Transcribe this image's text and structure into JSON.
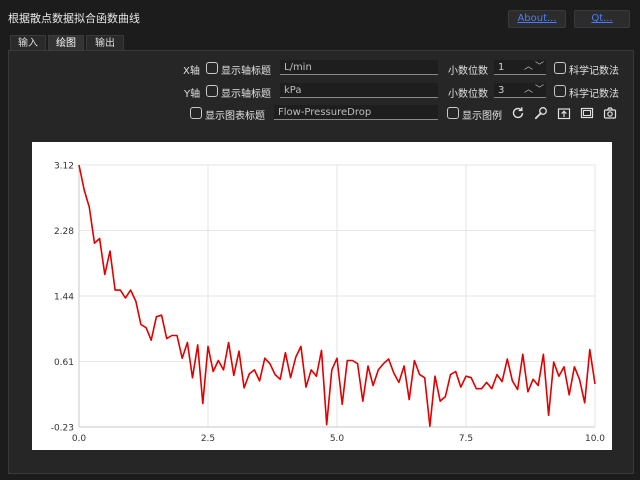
{
  "window": {
    "title": "根据散点数据拟合函数曲线",
    "about_label": "About...",
    "qt_label": "Qt..."
  },
  "tabs": [
    {
      "label": "输入",
      "active": false
    },
    {
      "label": "绘图",
      "active": true
    },
    {
      "label": "输出",
      "active": false
    }
  ],
  "controls": {
    "x_axis": {
      "axis_label": "X轴",
      "show_title_label": "显示轴标题",
      "title_value": "L/min",
      "decimals_label": "小数位数",
      "decimals_value": "1",
      "sci_label": "科学记数法"
    },
    "y_axis": {
      "axis_label": "Y轴",
      "show_title_label": "显示轴标题",
      "title_value": "kPa",
      "decimals_label": "小数位数",
      "decimals_value": "3",
      "sci_label": "科学记数法"
    },
    "chart_title": {
      "show_label": "显示图表标题",
      "value": "Flow-PressureDrop"
    },
    "legend_label": "显示图例",
    "icons": [
      "refresh-icon",
      "wrench-icon",
      "export-icon",
      "fullscreen-icon",
      "camera-icon"
    ]
  },
  "chart_data": {
    "type": "line",
    "title": "",
    "xlabel": "",
    "ylabel": "",
    "xlim": [
      0,
      10
    ],
    "ylim": [
      -0.23,
      3.12
    ],
    "xticks": [
      "0.0",
      "2.5",
      "5.0",
      "7.5",
      "10.0"
    ],
    "yticks": [
      "3.12",
      "2.28",
      "1.44",
      "0.61",
      "-0.23"
    ],
    "grid": true,
    "line_color": "#e00000",
    "x": [
      0.0,
      0.1,
      0.2,
      0.3,
      0.4,
      0.5,
      0.6,
      0.7,
      0.8,
      0.9,
      1.0,
      1.1,
      1.2,
      1.3,
      1.4,
      1.5,
      1.6,
      1.7,
      1.8,
      1.9,
      2.0,
      2.1,
      2.2,
      2.3,
      2.4,
      2.5,
      2.6,
      2.7,
      2.8,
      2.9,
      3.0,
      3.1,
      3.2,
      3.3,
      3.4,
      3.5,
      3.6,
      3.7,
      3.8,
      3.9,
      4.0,
      4.1,
      4.2,
      4.3,
      4.4,
      4.5,
      4.6,
      4.7,
      4.8,
      4.9,
      5.0,
      5.1,
      5.2,
      5.3,
      5.4,
      5.5,
      5.6,
      5.7,
      5.8,
      5.9,
      6.0,
      6.1,
      6.2,
      6.3,
      6.4,
      6.5,
      6.6,
      6.7,
      6.8,
      6.9,
      7.0,
      7.1,
      7.2,
      7.3,
      7.4,
      7.5,
      7.6,
      7.7,
      7.8,
      7.9,
      8.0,
      8.1,
      8.2,
      8.3,
      8.4,
      8.5,
      8.6,
      8.7,
      8.8,
      8.9,
      9.0,
      9.1,
      9.2,
      9.3,
      9.4,
      9.5,
      9.6,
      9.7,
      9.8,
      9.9,
      10.0
    ],
    "y": [
      3.12,
      2.8,
      2.58,
      2.12,
      2.18,
      1.72,
      2.02,
      1.52,
      1.52,
      1.42,
      1.52,
      1.38,
      1.08,
      1.04,
      0.88,
      1.18,
      1.2,
      0.9,
      0.94,
      0.94,
      0.65,
      0.85,
      0.4,
      0.82,
      0.07,
      0.8,
      0.48,
      0.62,
      0.5,
      0.85,
      0.43,
      0.74,
      0.27,
      0.45,
      0.5,
      0.36,
      0.65,
      0.58,
      0.44,
      0.38,
      0.72,
      0.4,
      0.66,
      0.8,
      0.28,
      0.5,
      0.42,
      0.75,
      -0.2,
      0.5,
      0.65,
      0.06,
      0.62,
      0.62,
      0.58,
      0.1,
      0.55,
      0.3,
      0.5,
      0.58,
      0.64,
      0.46,
      0.34,
      0.55,
      0.12,
      0.62,
      0.44,
      0.4,
      -0.22,
      0.42,
      0.1,
      0.16,
      0.44,
      0.48,
      0.28,
      0.42,
      0.4,
      0.26,
      0.26,
      0.34,
      0.26,
      0.44,
      0.35,
      0.64,
      0.36,
      0.25,
      0.7,
      0.22,
      0.38,
      0.3,
      0.7,
      -0.08,
      0.6,
      0.42,
      0.54,
      0.18,
      0.54,
      0.38,
      0.08,
      0.76,
      0.32,
      0.34,
      0.44
    ]
  }
}
